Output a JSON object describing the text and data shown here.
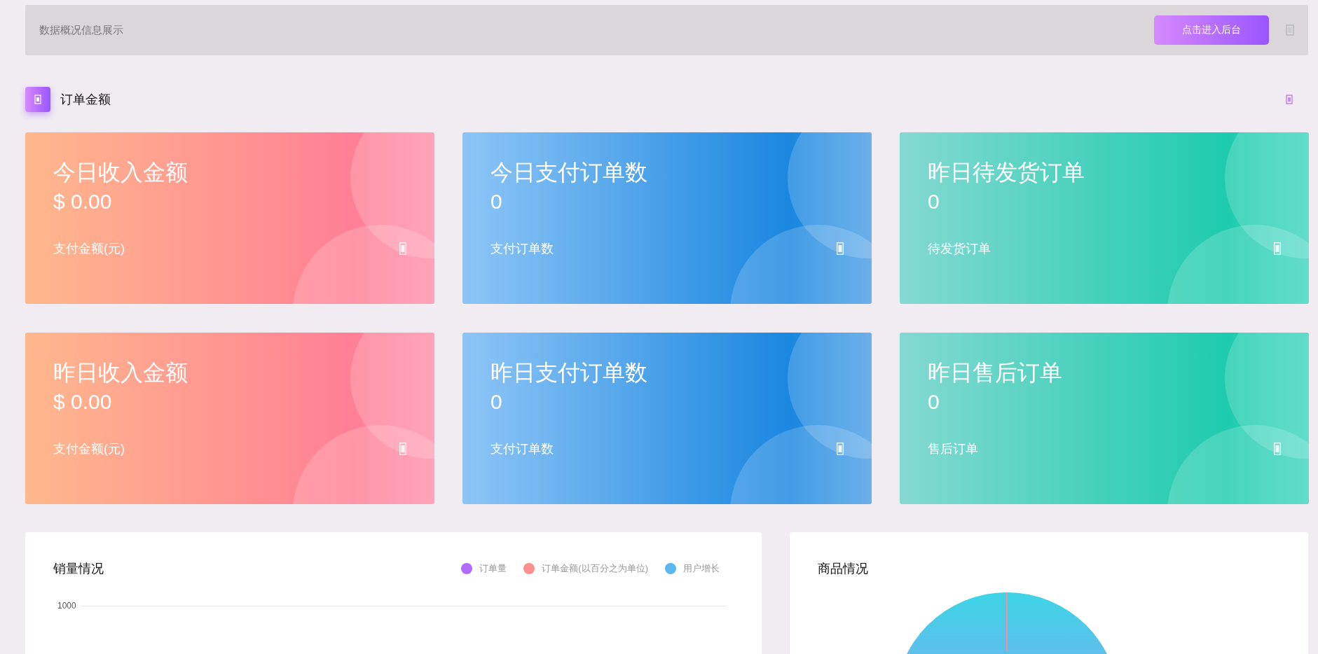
{
  "header": {
    "title": "数据概况信息展示",
    "button": "点击进入后台"
  },
  "section": {
    "title": "订单金额"
  },
  "cards": [
    {
      "kind": "pink",
      "title": "今日收入金额",
      "value": "$ 0.00",
      "caption": "支付金额(元)"
    },
    {
      "kind": "blue",
      "title": "今日支付订单数",
      "value": "0",
      "caption": "支付订单数"
    },
    {
      "kind": "teal",
      "title": "昨日待发货订单",
      "value": "0",
      "caption": "待发货订单"
    },
    {
      "kind": "pink",
      "title": "昨日收入金额",
      "value": "$ 0.00",
      "caption": "支付金额(元)"
    },
    {
      "kind": "blue",
      "title": "昨日支付订单数",
      "value": "0",
      "caption": "支付订单数"
    },
    {
      "kind": "teal",
      "title": "昨日售后订单",
      "value": "0",
      "caption": "售后订单"
    }
  ],
  "sales": {
    "title": "销量情况",
    "legend": [
      {
        "label": "订单量",
        "color": "#b36bff"
      },
      {
        "label": "订单金额(以百分之为单位)",
        "color": "#ff8f8f"
      },
      {
        "label": "用户增长",
        "color": "#5ab7f0"
      }
    ],
    "axis_label": "1000"
  },
  "products": {
    "title": "商品情况"
  }
}
